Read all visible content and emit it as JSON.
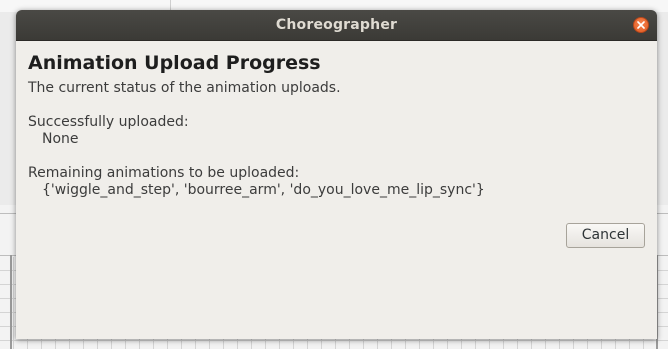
{
  "window": {
    "title": "Choreographer"
  },
  "dialog": {
    "heading": "Animation Upload Progress",
    "subtitle": "The current status of the animation uploads.",
    "successful_label": "Successfully uploaded:",
    "successful_value": "None",
    "remaining_label": "Remaining animations to be uploaded:",
    "remaining_value": "{'wiggle_and_step', 'bourree_arm', 'do_you_love_me_lip_sync'}",
    "cancel_label": "Cancel"
  },
  "icons": {
    "close": "close-icon"
  },
  "colors": {
    "titlebar": "#3b3a36",
    "close_button": "#e25a20",
    "dialog_background": "#f0eeea"
  }
}
